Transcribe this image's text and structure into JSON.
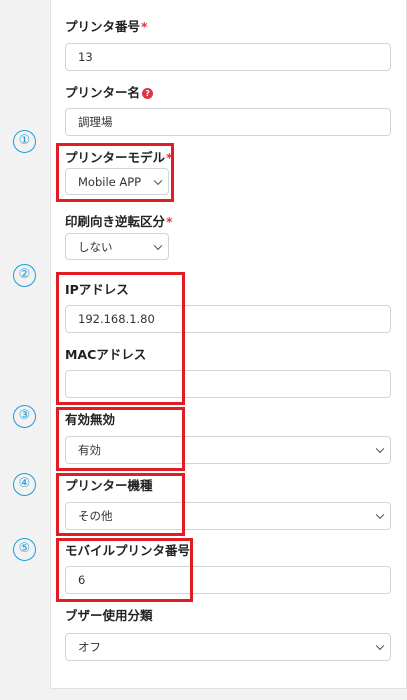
{
  "form": {
    "printer_number": {
      "label": "プリンタ番号",
      "required_mark": "*",
      "value": "13"
    },
    "printer_name": {
      "label": "プリンター名",
      "help_icon": "question-circle-icon",
      "value": "調理場"
    },
    "printer_model": {
      "label": "プリンターモデル",
      "required_mark": "*",
      "selected": "Mobile APP"
    },
    "print_direction": {
      "label": "印刷向き逆転区分",
      "required_mark": "*",
      "selected": "しない"
    },
    "ip_address": {
      "label": "IPアドレス",
      "value": "192.168.1.80"
    },
    "mac_address": {
      "label": "MACアドレス",
      "value": ""
    },
    "enabled": {
      "label": "有効無効",
      "selected": "有効"
    },
    "printer_type": {
      "label": "プリンター機種",
      "selected": "その他"
    },
    "mobile_printer_number": {
      "label": "モバイルプリンタ番号",
      "value": "6"
    },
    "buzzer": {
      "label": "ブザー使用分類",
      "selected": "オフ"
    }
  },
  "annotations": {
    "markers": [
      "①",
      "②",
      "③",
      "④",
      "⑤"
    ],
    "marker_color": "#1f9bd8",
    "highlight_color": "#e01c24"
  }
}
